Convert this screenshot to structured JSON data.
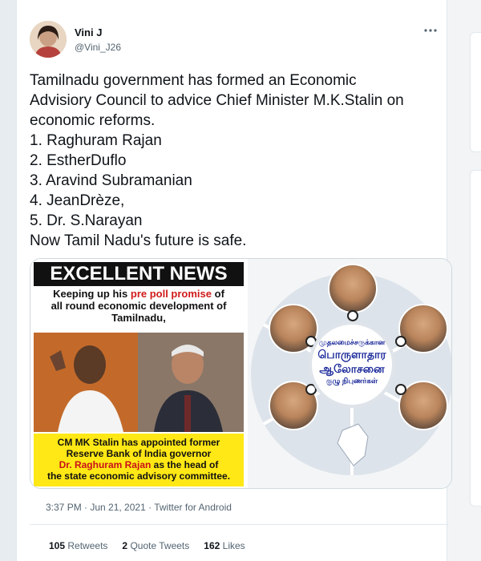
{
  "author": {
    "display_name": "Vini J",
    "handle": "@Vini_J26"
  },
  "tweet": {
    "lines": [
      "Tamilnadu government has formed an Economic",
      "Advisiory Council to advice Chief Minister M.K.Stalin on",
      "economic reforms.",
      "1. Raghuram Rajan",
      "2. EstherDuflo",
      "3. Aravind Subramanian",
      "4. JeanDrèze,",
      "5. Dr. S.Narayan",
      "Now Tamil Nadu's future is safe."
    ]
  },
  "media": {
    "left": {
      "banner": "EXCELLENT NEWS",
      "sub_line1_pre": "Keeping up his ",
      "sub_line1_red": "pre poll promise",
      "sub_line1_post": " of",
      "sub_line2": "all round economic development of",
      "sub_line3": "Tamilnadu,",
      "yellow_line1": "CM MK Stalin has appointed former",
      "yellow_line2": "Reserve Bank of India governor",
      "yellow_line3_red": "Dr. Raghuram Rajan",
      "yellow_line3_post": " as the head of",
      "yellow_line4": "the state economic advisory committee."
    },
    "right": {
      "tamil_line1": "முதலமைச்சருக்கான",
      "tamil_line2": "பொருளாதார",
      "tamil_line3": "ஆலோசனை",
      "tamil_line4": "குழு நிபுணர்கள்"
    }
  },
  "footer": {
    "timestamp": "3:37 PM · Jun 21, 2021 · Twitter for Android",
    "retweets_count": "105",
    "retweets_label": "Retweets",
    "quotes_count": "2",
    "quotes_label": "Quote Tweets",
    "likes_count": "162",
    "likes_label": "Likes"
  },
  "icons": {
    "more": "more-horizontal-icon"
  },
  "colors": {
    "text": "#0f1419",
    "secondary": "#536471",
    "yellow": "#ffe815",
    "accent_red": "#d11a1a"
  }
}
